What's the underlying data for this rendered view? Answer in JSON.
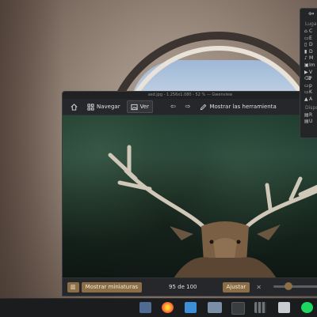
{
  "window": {
    "title": "asd.jpg - 1.256x1.080 - 52 % — Gwenview"
  },
  "toolbar": {
    "home_icon": "home-icon",
    "browse_label": "Navegar",
    "view_label": "Ver",
    "back_icon": "arrow-left-icon",
    "forward_icon": "arrow-right-icon",
    "tools_label": "Mostrar las herramienta"
  },
  "statusbar": {
    "thumbs_label": "Mostrar miniaturas",
    "count": "95 de 100",
    "fit_label": "Ajustar"
  },
  "places": {
    "back_glyph": "⇦",
    "heading": "Lugares",
    "devices_heading": "Dispo",
    "items": [
      {
        "icon": "⌂",
        "label": "C"
      },
      {
        "icon": "▭",
        "label": "E"
      },
      {
        "icon": "▯",
        "label": "D"
      },
      {
        "icon": "▮",
        "label": "D"
      },
      {
        "icon": "♪",
        "label": "M"
      },
      {
        "icon": "▣",
        "label": "Im"
      },
      {
        "icon": "▶",
        "label": "V"
      },
      {
        "icon": "⌫",
        "label": "P"
      },
      {
        "icon": "▭",
        "label": "p"
      },
      {
        "icon": "▭",
        "label": "K"
      },
      {
        "icon": "▲",
        "label": "A"
      }
    ],
    "devices": [
      {
        "icon": "▤",
        "label": "R"
      },
      {
        "icon": "▤",
        "label": "U"
      }
    ]
  },
  "taskbar": {
    "apps": [
      "file-manager-icon",
      "firefox-icon",
      "folder-icon",
      "image-viewer-icon",
      "terminal-icon",
      "grid-app-icon",
      "store-icon",
      "spotify-icon"
    ]
  },
  "colors": {
    "accent": "#8b6e45",
    "window_bg": "#1f2123",
    "taskbar_bg": "#1b1c1e"
  }
}
